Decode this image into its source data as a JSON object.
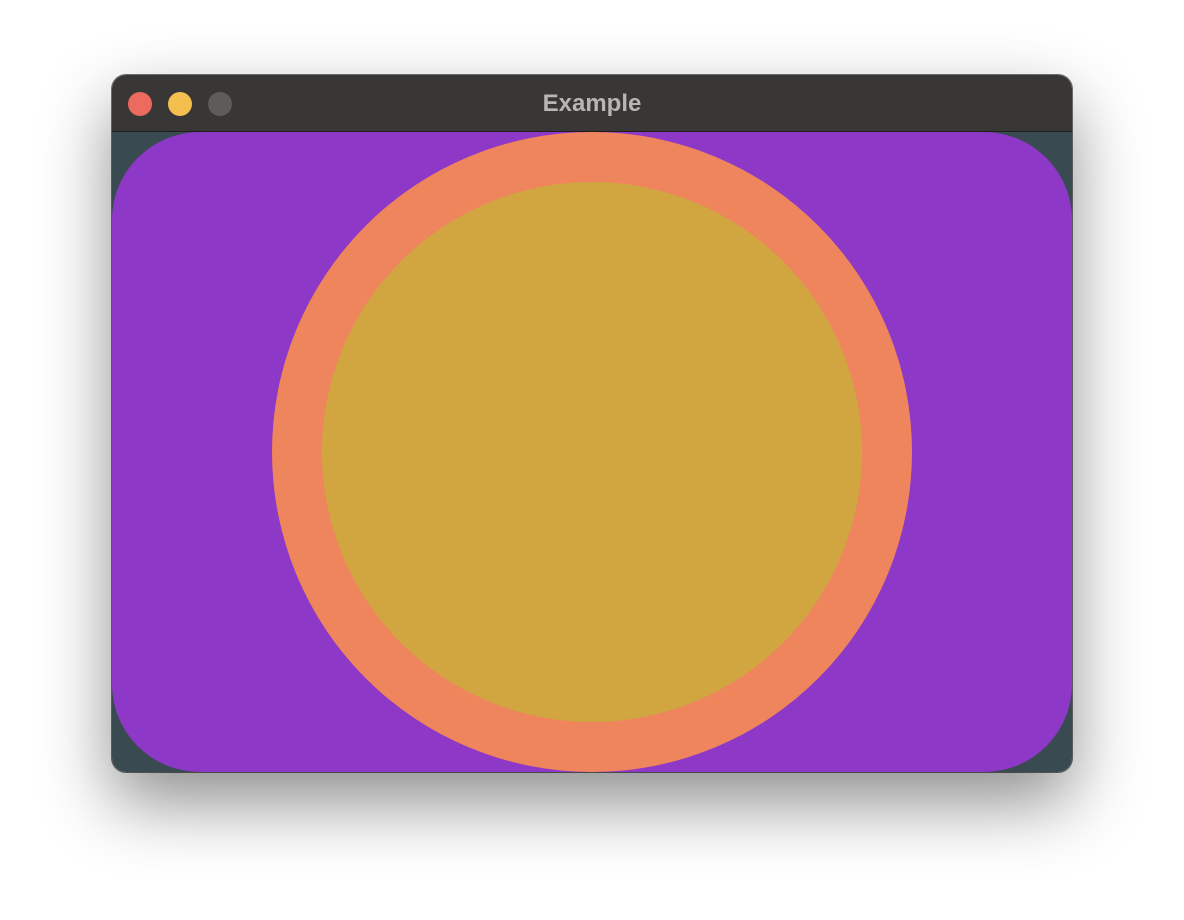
{
  "window": {
    "title": "Example"
  },
  "colors": {
    "titlebar": "#393735",
    "title_text": "#b8b6b4",
    "close": "#ed6a5e",
    "minimize": "#f5bf4f",
    "maximize_disabled": "#5d5c5b",
    "content_background": "#394b50",
    "rounded_rect": "#8e38c7",
    "outer_circle": "#ef855c",
    "inner_circle": "#d1a641"
  },
  "icons": {
    "close": "close-button-circle",
    "minimize": "minimize-button-circle",
    "maximize": "maximize-button-circle"
  }
}
